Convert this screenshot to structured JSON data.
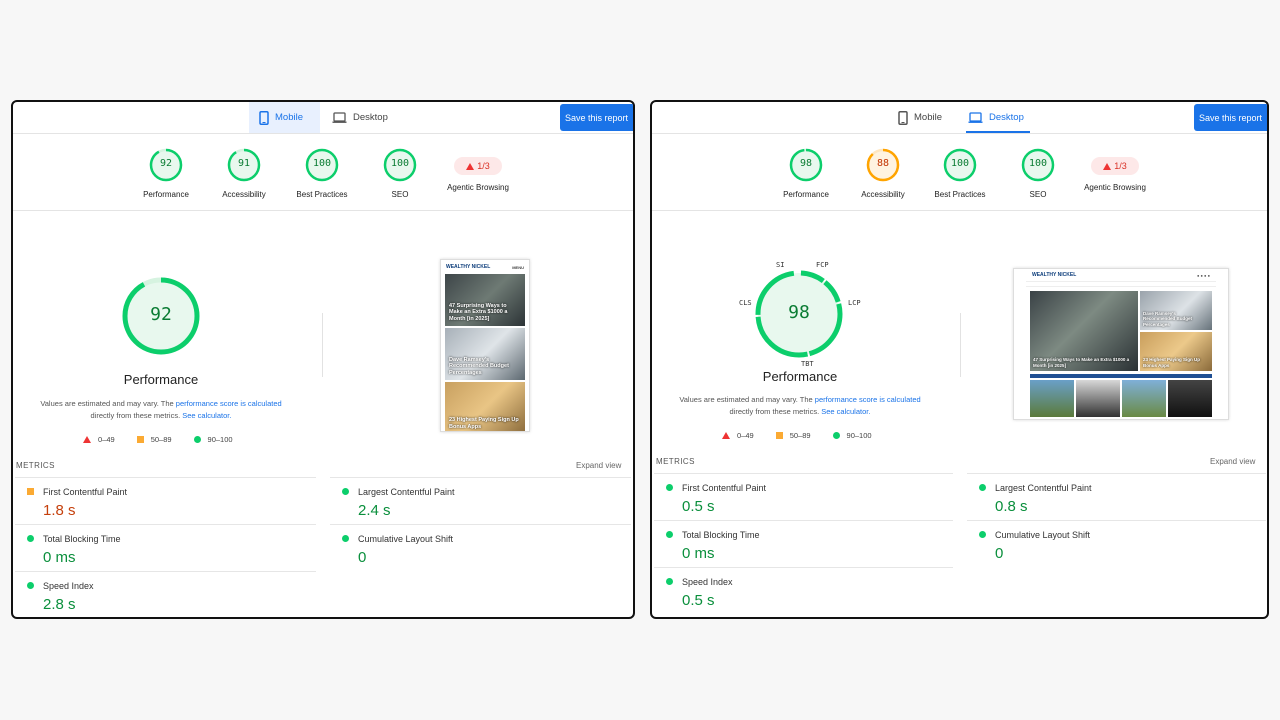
{
  "mobile": {
    "tabs": [
      {
        "label": "Mobile",
        "active": true
      },
      {
        "label": "Desktop",
        "active": false
      }
    ],
    "save_label": "Save this report",
    "categories": [
      {
        "label": "Performance",
        "score": "92"
      },
      {
        "label": "Accessibility",
        "score": "91"
      },
      {
        "label": "Best Practices",
        "score": "100"
      },
      {
        "label": "SEO",
        "score": "100"
      },
      {
        "label": "Agentic Browsing",
        "score": "1/3"
      }
    ],
    "main_score": "92",
    "main_label": "Performance",
    "disclaimer_a": "Values are estimated and may vary. The ",
    "disclaimer_link1": "performance score is calculated",
    "disclaimer_b": "directly from these metrics. ",
    "disclaimer_link2": "See calculator.",
    "legend": [
      "0–49",
      "50–89",
      "90–100"
    ],
    "metrics_header": "METRICS",
    "expand_label": "Expand view",
    "metrics": [
      {
        "name": "First Contentful Paint",
        "value": "1.8 s",
        "rating": "average"
      },
      {
        "name": "Largest Contentful Paint",
        "value": "2.4 s",
        "rating": "good"
      },
      {
        "name": "Total Blocking Time",
        "value": "0 ms",
        "rating": "good"
      },
      {
        "name": "Cumulative Layout Shift",
        "value": "0",
        "rating": "good"
      },
      {
        "name": "Speed Index",
        "value": "2.8 s",
        "rating": "good"
      }
    ],
    "thumbnail": {
      "site": "WEALTHY NICKEL",
      "menu": "MENU",
      "cards": [
        "47 Surprising Ways to Make an Extra $1000 a Month [in 2025]",
        "Dave Ramsey's Recommended Budget Percentages",
        "23 Highest Paying Sign Up Bonus Apps"
      ]
    }
  },
  "desktop": {
    "tabs": [
      {
        "label": "Mobile",
        "active": false
      },
      {
        "label": "Desktop",
        "active": true
      }
    ],
    "save_label": "Save this report",
    "categories": [
      {
        "label": "Performance",
        "score": "98"
      },
      {
        "label": "Accessibility",
        "score": "88"
      },
      {
        "label": "Best Practices",
        "score": "100"
      },
      {
        "label": "SEO",
        "score": "100"
      },
      {
        "label": "Agentic Browsing",
        "score": "1/3"
      }
    ],
    "main_score": "98",
    "main_label": "Performance",
    "gauge_labels": {
      "si": "SI",
      "fcp": "FCP",
      "lcp": "LCP",
      "tbt": "TBT",
      "cls": "CLS"
    },
    "disclaimer_a": "Values are estimated and may vary. The ",
    "disclaimer_link1": "performance score is calculated",
    "disclaimer_b": "directly from these metrics. ",
    "disclaimer_link2": "See calculator.",
    "legend": [
      "0–49",
      "50–89",
      "90–100"
    ],
    "metrics_header": "METRICS",
    "expand_label": "Expand view",
    "metrics": [
      {
        "name": "First Contentful Paint",
        "value": "0.5 s",
        "rating": "good"
      },
      {
        "name": "Largest Contentful Paint",
        "value": "0.8 s",
        "rating": "good"
      },
      {
        "name": "Total Blocking Time",
        "value": "0 ms",
        "rating": "good"
      },
      {
        "name": "Cumulative Layout Shift",
        "value": "0",
        "rating": "good"
      },
      {
        "name": "Speed Index",
        "value": "0.5 s",
        "rating": "good"
      }
    ],
    "thumbnail": {
      "site": "WEALTHY NICKEL",
      "cards": [
        "47 Surprising Ways to Make an Extra $1000 a Month [in 2025]",
        "Dave Ramsey's Recommended Budget Percentages",
        "23 Highest Paying Sign Up Bonus Apps"
      ]
    }
  },
  "colors": {
    "good": "#0cce6b",
    "average": "#ffa400",
    "poor": "#ff4e42",
    "accent": "#1a73e8"
  }
}
